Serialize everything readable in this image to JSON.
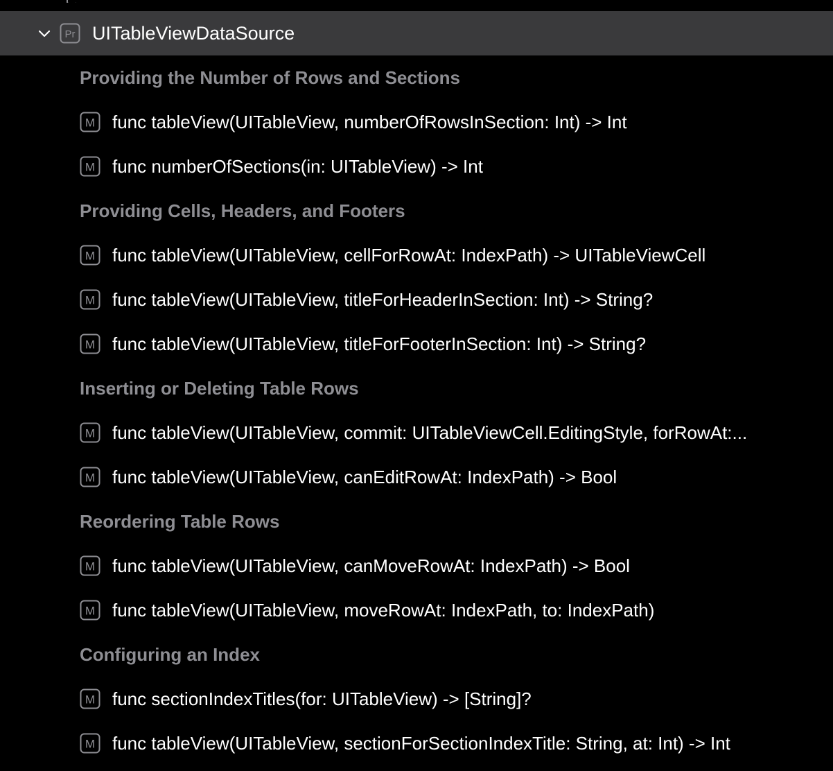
{
  "header": {
    "title": "UITableViewDataSource",
    "icon_text": "Pr",
    "icon_name": "protocol-icon"
  },
  "method_icon_text": "M",
  "colors": {
    "background": "#000000",
    "header_row": "#3a3a3c",
    "section_text": "#8e8e93",
    "item_text": "#ffffff",
    "icon_stroke": "#8e8e93"
  },
  "rows": [
    {
      "kind": "section",
      "label": "Providing the Number of Rows and Sections"
    },
    {
      "kind": "method",
      "label": "func tableView(UITableView, numberOfRowsInSection: Int) -> Int"
    },
    {
      "kind": "method",
      "label": "func numberOfSections(in: UITableView) -> Int"
    },
    {
      "kind": "section",
      "label": "Providing Cells, Headers, and Footers"
    },
    {
      "kind": "method",
      "label": "func tableView(UITableView, cellForRowAt: IndexPath) -> UITableViewCell"
    },
    {
      "kind": "method",
      "label": "func tableView(UITableView, titleForHeaderInSection: Int) -> String?"
    },
    {
      "kind": "method",
      "label": "func tableView(UITableView, titleForFooterInSection: Int) -> String?"
    },
    {
      "kind": "section",
      "label": "Inserting or Deleting Table Rows"
    },
    {
      "kind": "method",
      "label": "func tableView(UITableView, commit: UITableViewCell.EditingStyle, forRowAt:..."
    },
    {
      "kind": "method",
      "label": "func tableView(UITableView, canEditRowAt: IndexPath) -> Bool"
    },
    {
      "kind": "section",
      "label": "Reordering Table Rows"
    },
    {
      "kind": "method",
      "label": "func tableView(UITableView, canMoveRowAt: IndexPath) -> Bool"
    },
    {
      "kind": "method",
      "label": "func tableView(UITableView, moveRowAt: IndexPath, to: IndexPath)"
    },
    {
      "kind": "section",
      "label": "Configuring an Index"
    },
    {
      "kind": "method",
      "label": "func sectionIndexTitles(for: UITableView) -> [String]?"
    },
    {
      "kind": "method",
      "label": "func tableView(UITableView, sectionForSectionIndexTitle: String, at: Int) -> Int"
    }
  ]
}
